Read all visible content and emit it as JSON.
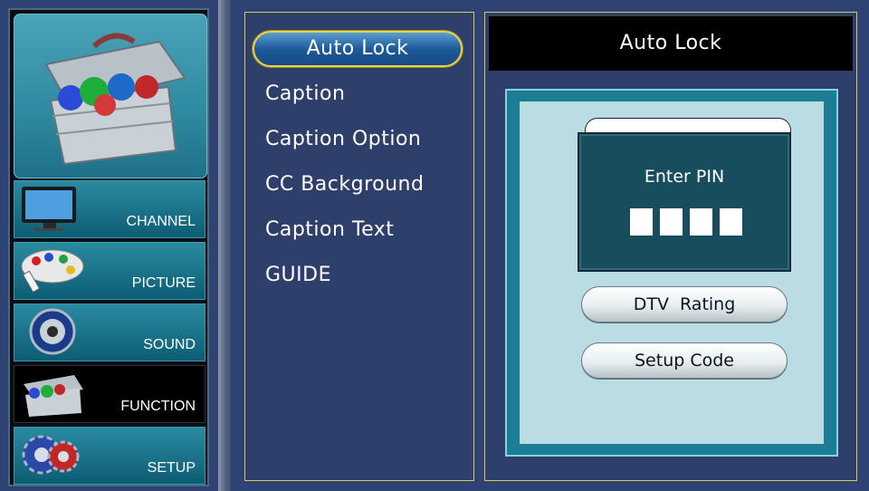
{
  "sidebar": {
    "items": [
      {
        "label": "CHANNEL",
        "icon": "tv-icon"
      },
      {
        "label": "PICTURE",
        "icon": "paint-palette-icon"
      },
      {
        "label": "SOUND",
        "icon": "speaker-icon"
      },
      {
        "label": "FUNCTION",
        "icon": "toolbox-icon",
        "active": true
      },
      {
        "label": "SETUP",
        "icon": "gears-icon"
      }
    ]
  },
  "menu": {
    "items": [
      "Auto Lock",
      "Caption",
      "Caption Option",
      "CC Background",
      "Caption Text",
      "GUIDE"
    ],
    "selected": "Auto Lock"
  },
  "detail": {
    "title": "Auto Lock",
    "pin_label": "Enter PIN",
    "buttons": [
      "DTV  Rating",
      "Setup Code"
    ]
  },
  "colors": {
    "background": "#2f4274",
    "highlight_border": "#e8d44c",
    "panel_border": "#d4cc55"
  }
}
